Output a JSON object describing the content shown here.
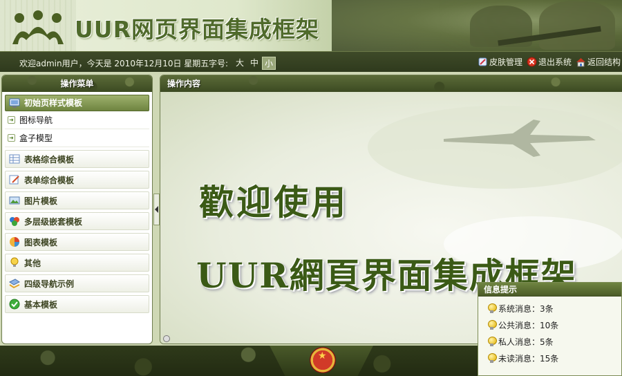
{
  "header": {
    "title": "UUR网页界面集成框架"
  },
  "infobar": {
    "welcome": "欢迎admin用户，今天是 2010年12月10日 星期五",
    "font_size_label": "字号:",
    "font_sizes": [
      "大",
      "中",
      "小"
    ],
    "active_font_size": "小",
    "links": [
      {
        "label": "皮肤管理",
        "icon": "skin-icon"
      },
      {
        "label": "退出系统",
        "icon": "exit-icon"
      },
      {
        "label": "返回结构",
        "icon": "home-icon"
      }
    ]
  },
  "left_panel": {
    "title": "操作菜单",
    "active_item": "初始页样式模板",
    "sub_items": [
      "图标导航",
      "盒子模型"
    ],
    "groups": [
      {
        "label": "表格综合模板",
        "icon": "table-icon"
      },
      {
        "label": "表单综合模板",
        "icon": "form-icon"
      },
      {
        "label": "图片模板",
        "icon": "image-icon"
      },
      {
        "label": "多层级嵌套模板",
        "icon": "nested-icon"
      },
      {
        "label": "图表模板",
        "icon": "chart-icon"
      },
      {
        "label": "其他",
        "icon": "bulb-icon"
      },
      {
        "label": "四级导航示例",
        "icon": "nav-icon"
      },
      {
        "label": "基本模板",
        "icon": "check-icon"
      }
    ]
  },
  "right_panel": {
    "title": "操作内容",
    "welcome_text": "歡迎使用",
    "frame_text": "UUR網頁界面集成框架"
  },
  "notification": {
    "title": "信息提示",
    "items": [
      "系统消息：3条",
      "公共消息：10条",
      "私人消息：5条",
      "未读消息：15条"
    ]
  }
}
